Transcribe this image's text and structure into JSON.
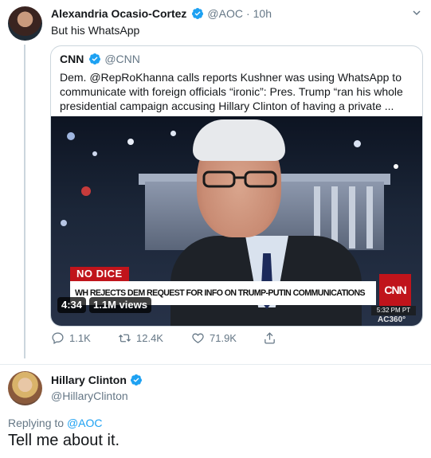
{
  "aoc_tweet": {
    "name": "Alexandria Ocasio-Cortez",
    "handle": "@AOC",
    "separator": "·",
    "time": "10h",
    "text": "But his WhatsApp"
  },
  "quoted_tweet": {
    "name": "CNN",
    "handle": "@CNN",
    "text": "Dem. @RepRoKhanna calls reports Kushner was using WhatsApp to communicate with foreign officials “ironic”: Pres. Trump “ran his whole presidential campaign accusing Hillary Clinton of having a private ...",
    "video": {
      "banner_tag": "NO DICE",
      "headline": "WH REJECTS DEM REQUEST FOR INFO ON TRUMP-PUTIN COMMUNICATIONS",
      "network_logo": "CNN",
      "timestamp": "5:32 PM PT",
      "show": "AC360°",
      "duration": "4:34",
      "views": "1.1M views"
    }
  },
  "actions": {
    "replies": "1.1K",
    "retweets": "12.4K",
    "likes": "71.9K"
  },
  "reply_tweet": {
    "name": "Hillary Clinton",
    "handle": "@HillaryClinton",
    "replying_prefix": "Replying to",
    "replying_to": "@AOC",
    "text": "Tell me about it."
  },
  "colors": {
    "accent": "#1da1f2",
    "muted": "#657786",
    "cnn_red": "#c0141b"
  }
}
